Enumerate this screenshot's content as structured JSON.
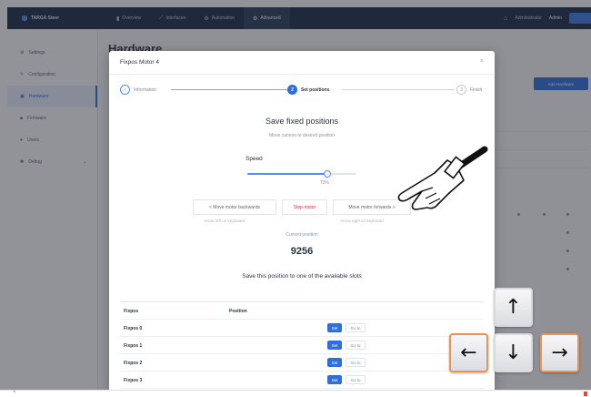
{
  "topbar": {
    "brand": "TARGA Steer",
    "nav": [
      {
        "label": "Overview",
        "icon": "chart-icon"
      },
      {
        "label": "Interfaces",
        "icon": "plug-icon"
      },
      {
        "label": "Automation",
        "icon": "gear-icon"
      },
      {
        "label": "Advanced",
        "icon": "sliders-icon"
      }
    ],
    "active_nav": "Advanced",
    "account_label": "Administrator",
    "user_label": "Admin"
  },
  "sidebar": {
    "items": [
      {
        "label": "Settings",
        "icon": "gear-icon"
      },
      {
        "label": "Configuration",
        "icon": "wrench-icon"
      },
      {
        "label": "Hardware",
        "icon": "chip-icon",
        "active": true
      },
      {
        "label": "Firmware",
        "icon": "box-icon"
      },
      {
        "label": "Users",
        "icon": "user-icon"
      },
      {
        "label": "Debug",
        "icon": "bug-icon",
        "has_children": true
      }
    ]
  },
  "background": {
    "title": "Hardware",
    "primary_button": "Add Hardware"
  },
  "dialog": {
    "title": "Fixpos Motor 4",
    "close_icon": "close-icon",
    "steps": [
      {
        "label": "Information",
        "state": "done",
        "marker": "✓"
      },
      {
        "label": "Set positions",
        "state": "current",
        "marker": "2"
      },
      {
        "label": "Finish",
        "state": "todo",
        "marker": "3"
      }
    ],
    "heading": "Save fixed positions",
    "subheading": "Move cannon to desired position",
    "speed": {
      "label": "Speed",
      "value_percent": 73,
      "value_text": "73%"
    },
    "buttons": {
      "backward": "< Move motor backwards",
      "stop": "Stop motor",
      "forward": "Move motor forwards >"
    },
    "hints": {
      "backward": "Arrow left on keyboard",
      "forward": "Arrow right on keyboard"
    },
    "current_position_label": "Current position",
    "current_position_value": "9256",
    "slots_heading": "Save this position to one of the available slots",
    "table": {
      "columns": [
        "Fixpos",
        "Position"
      ],
      "rows": [
        {
          "name": "Fixpos 0",
          "position": ""
        },
        {
          "name": "Fixpos 1",
          "position": ""
        },
        {
          "name": "Fixpos 2",
          "position": ""
        },
        {
          "name": "Fixpos 3",
          "position": ""
        }
      ],
      "set_label": "Set",
      "goto_label": "Go to"
    }
  },
  "arrow_keys": {
    "up": "↑",
    "left": "←",
    "down": "↓",
    "right": "→",
    "pressed": [
      "left",
      "right"
    ],
    "highlight_color": "#e89358"
  },
  "colors": {
    "topbar": "#1c2a44",
    "accent": "#2f6fdd",
    "stop": "#d8343a"
  }
}
